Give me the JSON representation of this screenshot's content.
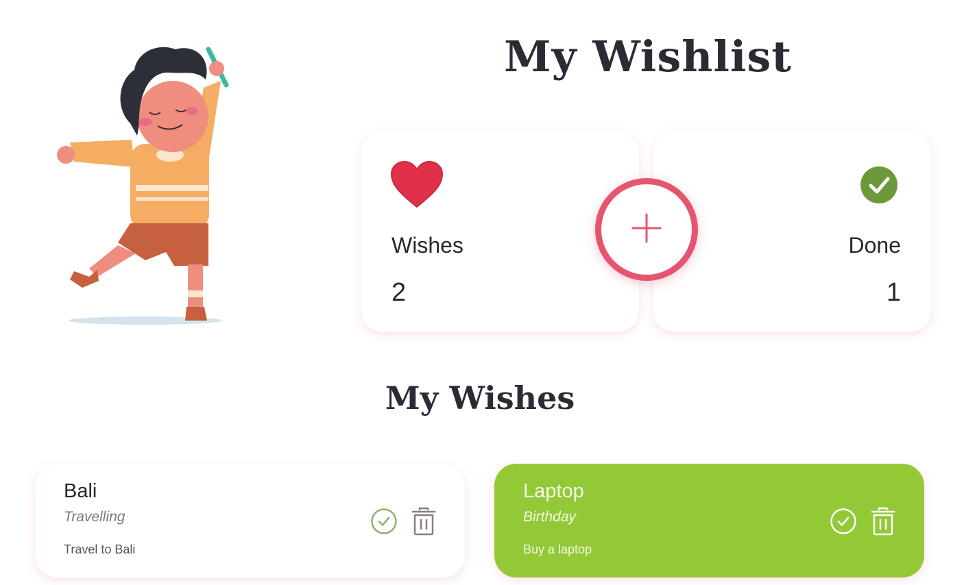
{
  "header": {
    "title": "My Wishlist"
  },
  "stats": {
    "wishes": {
      "label": "Wishes",
      "value": "2",
      "icon": "heart-icon",
      "color": "#e0304a"
    },
    "done": {
      "label": "Done",
      "value": "1",
      "icon": "check-circle-icon",
      "color": "#6c9a3a"
    }
  },
  "add_button": {
    "icon": "plus-icon",
    "color": "#e6556f"
  },
  "wishes_section": {
    "title": "My Wishes",
    "items": [
      {
        "title": "Bali",
        "category": "Travelling",
        "description": "Travel to Bali",
        "done": false
      },
      {
        "title": "Laptop",
        "category": "Birthday",
        "description": "Buy a laptop",
        "done": true,
        "color": "#93c936"
      }
    ]
  }
}
